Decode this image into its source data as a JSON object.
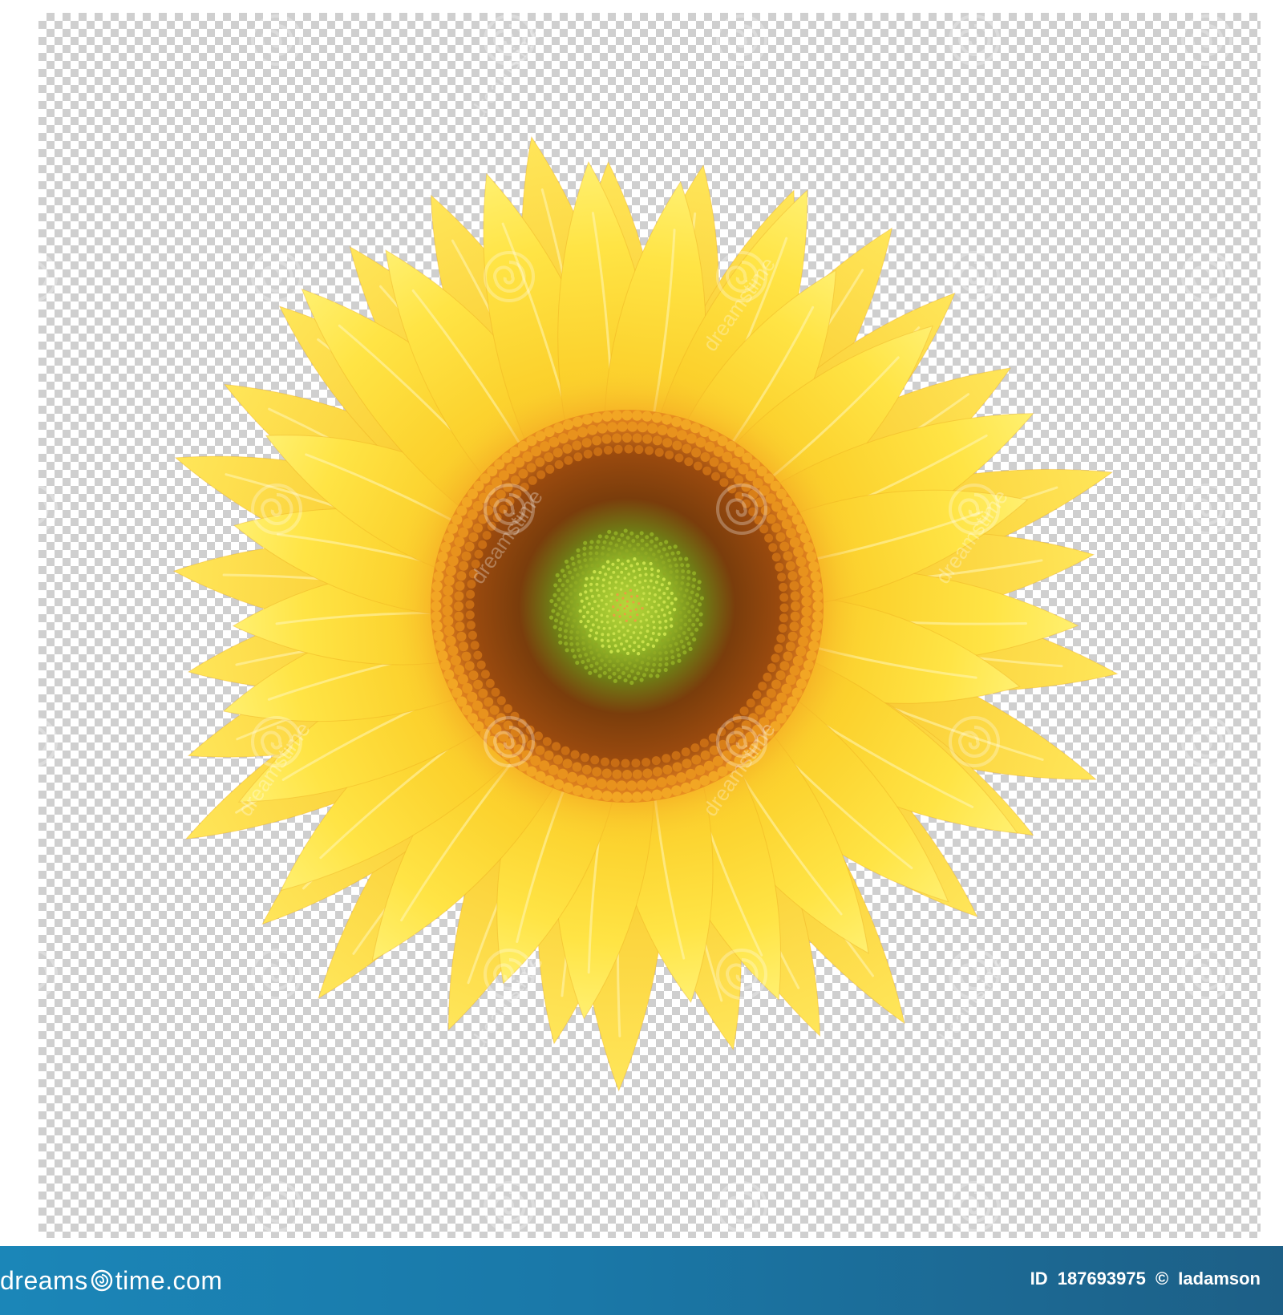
{
  "footer": {
    "brand_prefix": "dreams",
    "brand_suffix": "time.com",
    "id_label": "ID",
    "id_value": "187693975",
    "copyright_symbol": "©",
    "author": "Iadamson"
  },
  "watermark": {
    "text": "dreamstime",
    "logo_icon": "dreamstime-spiral-logo-icon"
  },
  "colors": {
    "footer_bar": "#1b7fb1",
    "petal_light": "#ffe94a",
    "petal_deep": "#f6b71a",
    "disc_ring": "#e88a1c",
    "disc_dark": "#7a3a0c",
    "disc_center": "#8fbf22"
  }
}
